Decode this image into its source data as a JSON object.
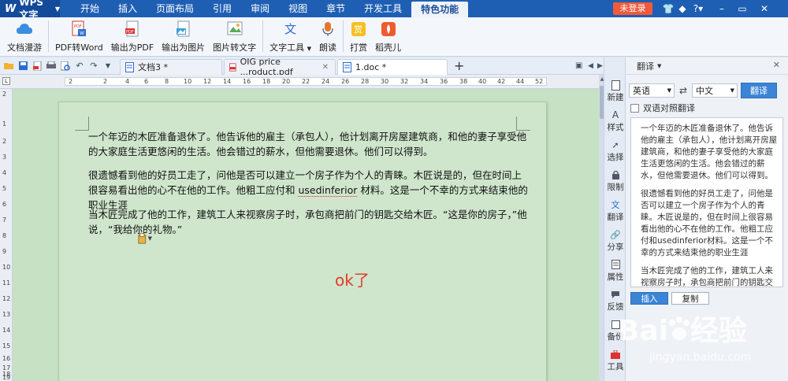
{
  "app": {
    "name": "WPS 文字"
  },
  "menu": [
    "开始",
    "插入",
    "页面布局",
    "引用",
    "审阅",
    "视图",
    "章节",
    "开发工具",
    "特色功能"
  ],
  "menu_active": "特色功能",
  "login_label": "未登录",
  "ribbon": {
    "doc_roam": "文档漫游",
    "pdf_to_word": "PDF转Word",
    "export_pdf": "输出为PDF",
    "export_image": "输出为图片",
    "image_to_text": "图片转文字",
    "text_tools": "文字工具",
    "read_aloud": "朗读",
    "reward": "打赏",
    "daoke": "稻壳儿"
  },
  "tabs": [
    {
      "label": "文档3 *",
      "icon": "doc-icon"
    },
    {
      "label": "OIG price ...roduct.pdf",
      "icon": "pdf-icon"
    },
    {
      "label": "1.doc *",
      "icon": "doc-icon"
    }
  ],
  "ruler": {
    "left_marker": "2",
    "right_marker": "52",
    "ticks": [
      "2",
      "2",
      "4",
      "6",
      "8",
      "10",
      "12",
      "14",
      "16",
      "18",
      "20",
      "22",
      "24",
      "26",
      "28",
      "30",
      "32",
      "34",
      "36",
      "38",
      "40",
      "42",
      "44",
      "46",
      "52"
    ]
  },
  "vruler": [
    "2",
    "1",
    "2",
    "3",
    "4",
    "5",
    "6",
    "7",
    "8",
    "9",
    "10",
    "11",
    "12",
    "13",
    "14",
    "15",
    "16",
    "17",
    "18",
    "19"
  ],
  "document": {
    "p1": "一个年迈的木匠准备退休了。他告诉他的雇主（承包人），他计划离开房屋建筑商，和他的妻子享受他的大家庭生活更悠闲的生活。他会错过的薪水，但他需要退休。他们可以得到。",
    "p2_a": "很遗憾看到他的好员工走了，问他是否可以建立一个房子作为个人的青睐。木匠说是的，但在时间上很容易看出他的心不在他的工作。他粗工应付和 ",
    "p2_err": "usedinferior",
    "p2_b": " 材料。这是一个不幸的方式来结束他的职业生涯",
    "p3": "当木匠完成了他的工作，建筑工人来视察房子时，承包商把前门的钥匙交给木匠。“这是你的房子，”他说，“我给你的礼物。”",
    "ok_text": "ok了"
  },
  "sidebar": [
    "新建",
    "样式",
    "选择",
    "限制",
    "翻译",
    "分享",
    "属性",
    "反馈",
    "备份",
    "工具"
  ],
  "translate": {
    "title": "翻译",
    "from_lang": "英语",
    "to_lang": "中文",
    "button": "翻译",
    "bilingual": "双语对照翻译",
    "result_p1": "一个年迈的木匠准备退休了。他告诉他的雇主（承包人），他计划离开房屋建筑商，和他的妻子享受他的大家庭生活更悠闲的生活。他会错过的薪水，但他需要退休。他们可以得到。",
    "result_p2": "很遗憾看到他的好员工走了，问他是否可以建立一个房子作为个人的青睐。木匠说是的，但在时间上很容易看出他的心不在他的工作。他粗工应付和usedinferior材料。这是一个不幸的方式来结束他的职业生涯",
    "result_p3": "当木匠完成了他的工作，建筑工人来视察房子时，承包商把前门的钥匙交给木匠。“这是你的房子，”他说，“我给你的礼物。”",
    "insert": "插入",
    "copy": "复制"
  },
  "watermark": {
    "logo": "Bai du 经验",
    "url": "jingyan.baidu.com"
  },
  "colors": {
    "title_bar": "#1f5fb3",
    "login": "#f05a3a",
    "page_bg": "#cfe6cc",
    "accent": "#3b84d6",
    "ok_red": "#e53a2a"
  }
}
